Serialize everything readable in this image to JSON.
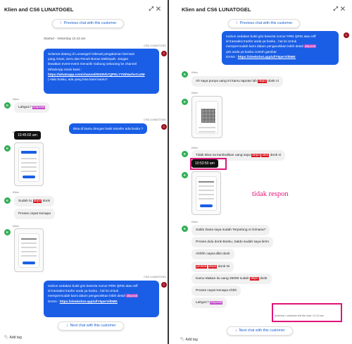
{
  "left": {
    "title": "Klien and CS6 LUNATOGEL",
    "header_icons": [
      "expand-icon",
      "close-icon"
    ],
    "prev_button": "Previous chat with this customer",
    "started": "Started - Yesterday 10.43 am",
    "agent_label": "CS6 LUNATOGEL",
    "agent_avatar": "C",
    "client_label": "Klien",
    "client_avatar": "K",
    "msg1_lines": [
      "Selamat datang di Lunatogel! Nikmati pengalaman bermain",
      "yang Aman, Seru dan Penuh Bonus Melimpah. Jangan",
      "lewatkan event-event menarik! Gabung sekarang ke channel",
      "WhatsApp resmi kami :"
    ],
    "msg1_link": "https://whatsapp.com/channel/0029Vb7QPEL7Y5tiNarhvCu2M",
    "msg1_tail": "| Halo bosku, ada yang bisa kami bantu?",
    "msg2_pre": "Lahgo1?",
    "msg2_hl": "Deposit",
    "msg3": "Bisa di bantu dengan bukti transfer ada bosku ?",
    "timestamp": "10:45:02 am",
    "msg4_pre": "Sudah tu",
    "msg4_hl": "depo",
    "msg4_post": "donk",
    "msg5": "Proses cepat Kenapa",
    "msg6_lines": [
      "mohon sedakan bukti gris beserta nomor RRN QRIS atau reff",
      "id transaksi tranfer anda ya bosku , hal ini Untuk",
      "mempermudah kami dalam pengecekkan lebih detail"
    ],
    "msg6_hl": "deposit",
    "msg6_mid": "DANA :",
    "msg6_link": "https://sleekshot.app/u/lY5perVil0MK",
    "next_button": "Next chat with this customer",
    "add_tag": "Add tag"
  },
  "right": {
    "title": "Klien and CS6 LUNATOGEL",
    "header_icons": [
      "expand-icon",
      "close-icon"
    ],
    "prev_button": "Previous chat with this customer",
    "agent_avatar": "C",
    "client_label": "Klien",
    "client_avatar": "K",
    "msg1_lines": [
      "mohon sedakan bukti gris beserta nomor RRN QRIS atau reff",
      "id transaksi tranfer anda ya bosku , hal ini Untuk",
      "mempermudah kami dalam pengecekkan lebih detail"
    ],
    "msg1_hl": "deposit",
    "msg1_mid": "qris anda ya bosku contoh gambar",
    "msg1_dana": "DANA :",
    "msg1_link": "https://sleekshot.app/u/lY5perVil0MK",
    "msg2_pre": "Ah saya punya uang ini kamu taputar lah",
    "msg2_hl": "depo",
    "msg2_post": "donk ni",
    "msg3_pre": "Tidak Bisa na kambalikan uang saya",
    "msg3_hl1": "depo",
    "msg3_hl2": "ulan",
    "msg3_post": "donk ni",
    "timestamp": "10:53:50 am",
    "annotation": "tidak respon",
    "msg4": "Saldo Dana saya sudah Terpotong ni Gimana?",
    "msg5": "Proses dulu donk Bosku, Saldo sudah saya kirim",
    "msg6": "Ahhhh cepat dikit donk",
    "msg7_hl1": "proses",
    "msg7_hl2": "depo",
    "msg7_post": "donk Ni",
    "msg8_pre": "Kamu Makan itu uang 25000 sudah",
    "msg8_hl": "depo",
    "msg8_post": "donk",
    "msg9_pre": "Proses cepat Kenapa Ahhh",
    "msg10_pre": "Lahgo1?",
    "msg10_hl": "Deposit",
    "system": "Archived • customer left the chat • 11:10 am",
    "next_button": "Next chat with this customer",
    "add_tag": "Add tag"
  }
}
